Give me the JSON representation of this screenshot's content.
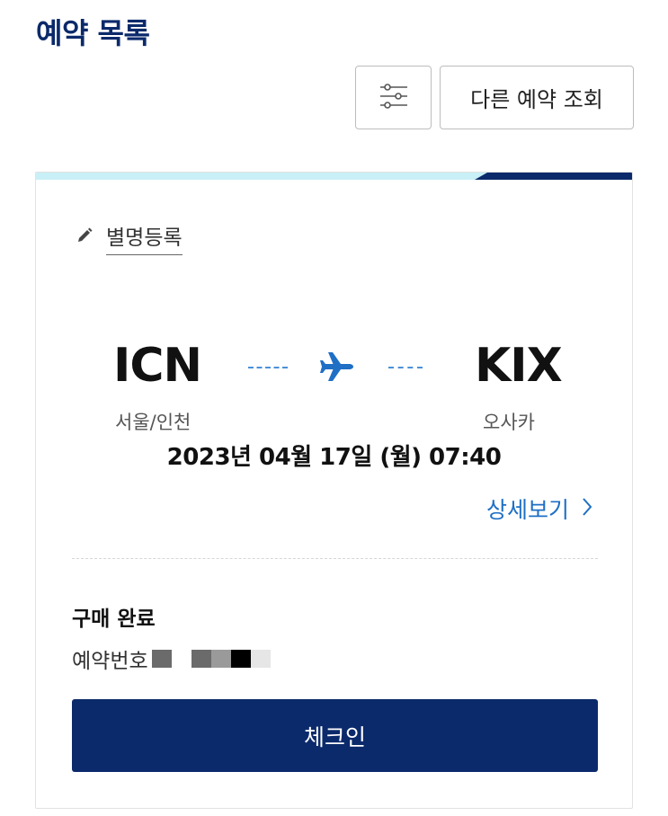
{
  "header": {
    "title": "예약 목록",
    "filter_icon": "sliders-icon",
    "other_booking_label": "다른 예약 조회"
  },
  "card": {
    "alias_icon": "pencil-icon",
    "alias_label": "별명등록",
    "origin": {
      "code": "ICN",
      "city": "서울/인천"
    },
    "destination": {
      "code": "KIX",
      "city": "오사카"
    },
    "route_icon": "airplane-icon",
    "datetime": "2023년 04월 17일 (월) 07:40",
    "detail_label": "상세보기",
    "detail_icon": "chevron-right-icon",
    "status": "구매 완료",
    "booking_number_label": "예약번호",
    "checkin_label": "체크인"
  },
  "colors": {
    "brand_navy": "#0b2a6b",
    "link_blue": "#1f6fc5",
    "accent_light": "#c9eff7"
  }
}
